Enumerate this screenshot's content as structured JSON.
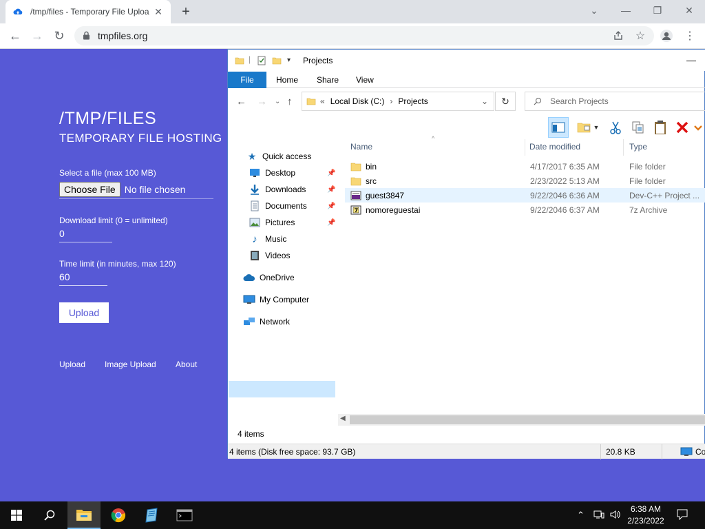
{
  "browser": {
    "tab_title": "/tmp/files - Temporary File Uploa",
    "url": "tmpfiles.org"
  },
  "site": {
    "title": "/TMP/FILES",
    "subtitle": "TEMPORARY FILE HOSTING",
    "file_label": "Select a file (max 100 MB)",
    "choose_file": "Choose File",
    "no_file": "No file chosen",
    "download_limit_label": "Download limit (0 = unlimited)",
    "download_limit_value": "0",
    "time_limit_label": "Time limit (in minutes, max 120)",
    "time_limit_value": "60",
    "upload_button": "Upload",
    "footer_links": [
      "Upload",
      "Image Upload",
      "About"
    ]
  },
  "explorer": {
    "title": "Projects",
    "ribbon_tabs": [
      "File",
      "Home",
      "Share",
      "View"
    ],
    "breadcrumb": [
      "Local Disk (C:)",
      "Projects"
    ],
    "breadcrumb_prefix": "«",
    "search_placeholder": "Search Projects",
    "nav": {
      "quick_access": "Quick access",
      "items": [
        "Desktop",
        "Downloads",
        "Documents",
        "Pictures",
        "Music",
        "Videos"
      ],
      "onedrive": "OneDrive",
      "my_computer": "My Computer",
      "network": "Network"
    },
    "columns": [
      "Name",
      "Date modified",
      "Type"
    ],
    "files": [
      {
        "name": "bin",
        "date": "4/17/2017 6:35 AM",
        "type": "File folder",
        "icon": "folder-icon"
      },
      {
        "name": "src",
        "date": "2/23/2022 5:13 AM",
        "type": "File folder",
        "icon": "folder-icon"
      },
      {
        "name": "guest3847",
        "date": "9/22/2046 6:36 AM",
        "type": "Dev-C++ Project ...",
        "icon": "devcpp-project-icon"
      },
      {
        "name": "nomoreguestai",
        "date": "9/22/2046 6:37 AM",
        "type": "7z Archive",
        "icon": "archive-icon"
      }
    ],
    "item_count": "4 items",
    "status": {
      "left": "4 items (Disk free space: 93.7 GB)",
      "size": "20.8 KB",
      "location": "Compu"
    }
  },
  "taskbar": {
    "time": "6:38 AM",
    "date": "2/23/2022"
  },
  "colors": {
    "page_bg": "#5759d6",
    "ribbon_file": "#1979ca",
    "selection": "#cce8ff"
  }
}
